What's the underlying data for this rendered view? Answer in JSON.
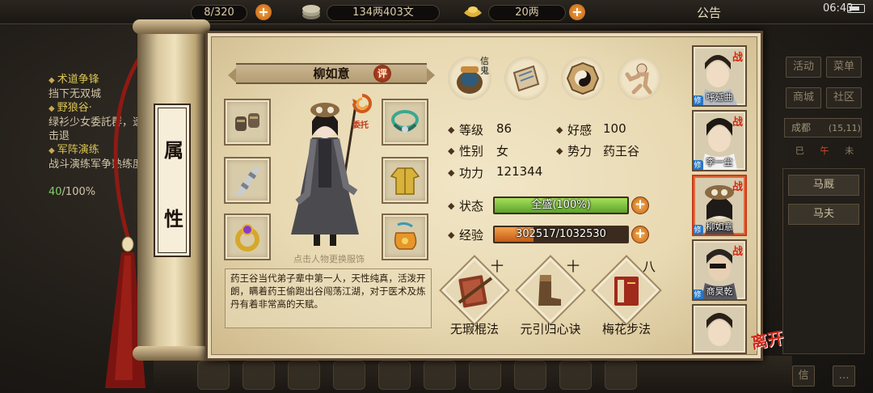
{
  "topbar": {
    "capacity": "8/320",
    "money": "134两403文",
    "gold": "20两",
    "notice": "公告",
    "time": "06:43"
  },
  "quests": [
    {
      "title": "术道争锋",
      "desc": "挡下无双城"
    },
    {
      "title": "野狼谷·",
      "desc": "绿衫少女委託群，速速击退"
    },
    {
      "title": "军阵演练",
      "desc": "战斗演练军争熟练度："
    }
  ],
  "quest_progress": {
    "done": "40",
    "total": "/100%"
  },
  "right_menu": {
    "buttons": [
      "活动",
      "菜单",
      "商城",
      "社区"
    ],
    "city": "成都",
    "coords": "(15,11)",
    "directions": [
      "巳",
      "午",
      "未"
    ],
    "tabs": [
      "马厩",
      "马夫"
    ],
    "footer": [
      "信",
      "…"
    ]
  },
  "scroll": {
    "chars": [
      "属",
      "性"
    ]
  },
  "character": {
    "name": "柳如意",
    "rate": "评",
    "entrust": "委托",
    "tap_hint": "点击人物更换服饰",
    "bio": "药王谷当代弟子辈中第一人，天性纯真，活泼开朗，瞒着药王偷跑出谷闯荡江湖，对于医术及炼丹有着非常高的天赋。"
  },
  "top_icons": [
    {
      "name": "pet-icon",
      "label": "信鬼"
    },
    {
      "name": "scroll-map-icon",
      "label": ""
    },
    {
      "name": "bagua-icon",
      "label": ""
    },
    {
      "name": "meridian-figure-icon",
      "label": ""
    }
  ],
  "stats": {
    "level_label": "等级",
    "level": "86",
    "favor_label": "好感",
    "favor": "100",
    "gender_label": "性别",
    "gender": "女",
    "faction_label": "势力",
    "faction": "药王谷",
    "power_label": "功力",
    "power": "121344",
    "status_label": "状态",
    "status": "全盛(100%)",
    "status_fraction": 1.0,
    "exp_label": "经验",
    "exp": "302517/1032530",
    "exp_fraction": 0.293
  },
  "skills": [
    {
      "name": "无瑕棍法",
      "level": "十"
    },
    {
      "name": "元引归心诀",
      "level": "十"
    },
    {
      "name": "梅花步法",
      "level": "八"
    }
  ],
  "roster": [
    {
      "name": "呼延曲",
      "tag": "战"
    },
    {
      "name": "李一尘",
      "tag": "战"
    },
    {
      "name": "柳如意",
      "tag": "战"
    },
    {
      "name": "商昊乾",
      "tag": "战"
    },
    {
      "name": "",
      "tag": ""
    }
  ],
  "roster_badge": "修",
  "leave": "离开",
  "colors": {
    "status_bar": "#7cc43a",
    "exp_bar": "#e07a22",
    "accent_red": "#c63b1a"
  }
}
